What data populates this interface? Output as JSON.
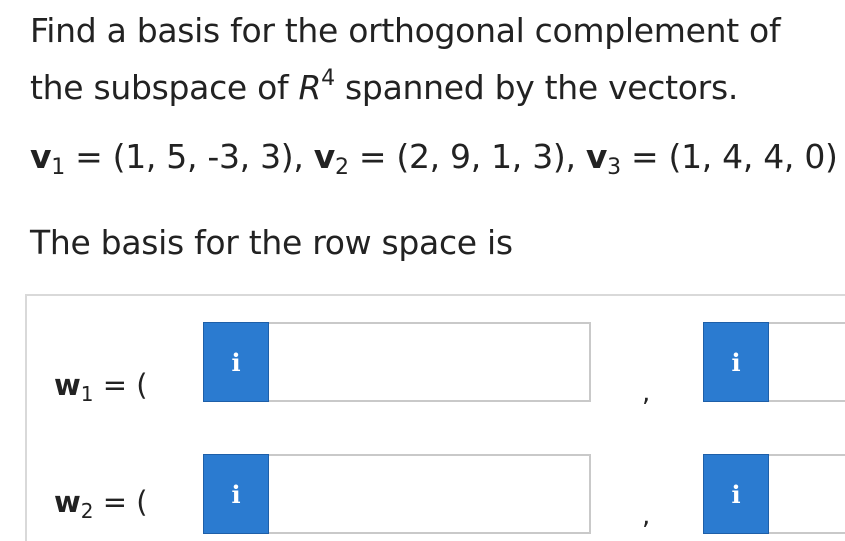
{
  "question": {
    "line_prefix": "Find a basis for the orthogonal complement of the subspace of ",
    "space_symbol": "R",
    "space_exponent": "4",
    "line_suffix": " spanned by the vectors."
  },
  "vectors": [
    {
      "name": "v",
      "index": "1",
      "value": "(1, 5, -3, 3)",
      "sep": ", "
    },
    {
      "name": "v",
      "index": "2",
      "value": "(2, 9, 1, 3)",
      "sep": ", "
    },
    {
      "name": "v",
      "index": "3",
      "value": "(1, 4, 4, 0)",
      "sep": ""
    }
  ],
  "row_space_text": "The basis for the row space is",
  "answers": [
    {
      "name": "w",
      "index": "1",
      "open": "= (",
      "info_label": "i",
      "separator": ","
    },
    {
      "name": "w",
      "index": "2",
      "open": "= (",
      "info_label": "i",
      "separator": ","
    }
  ]
}
